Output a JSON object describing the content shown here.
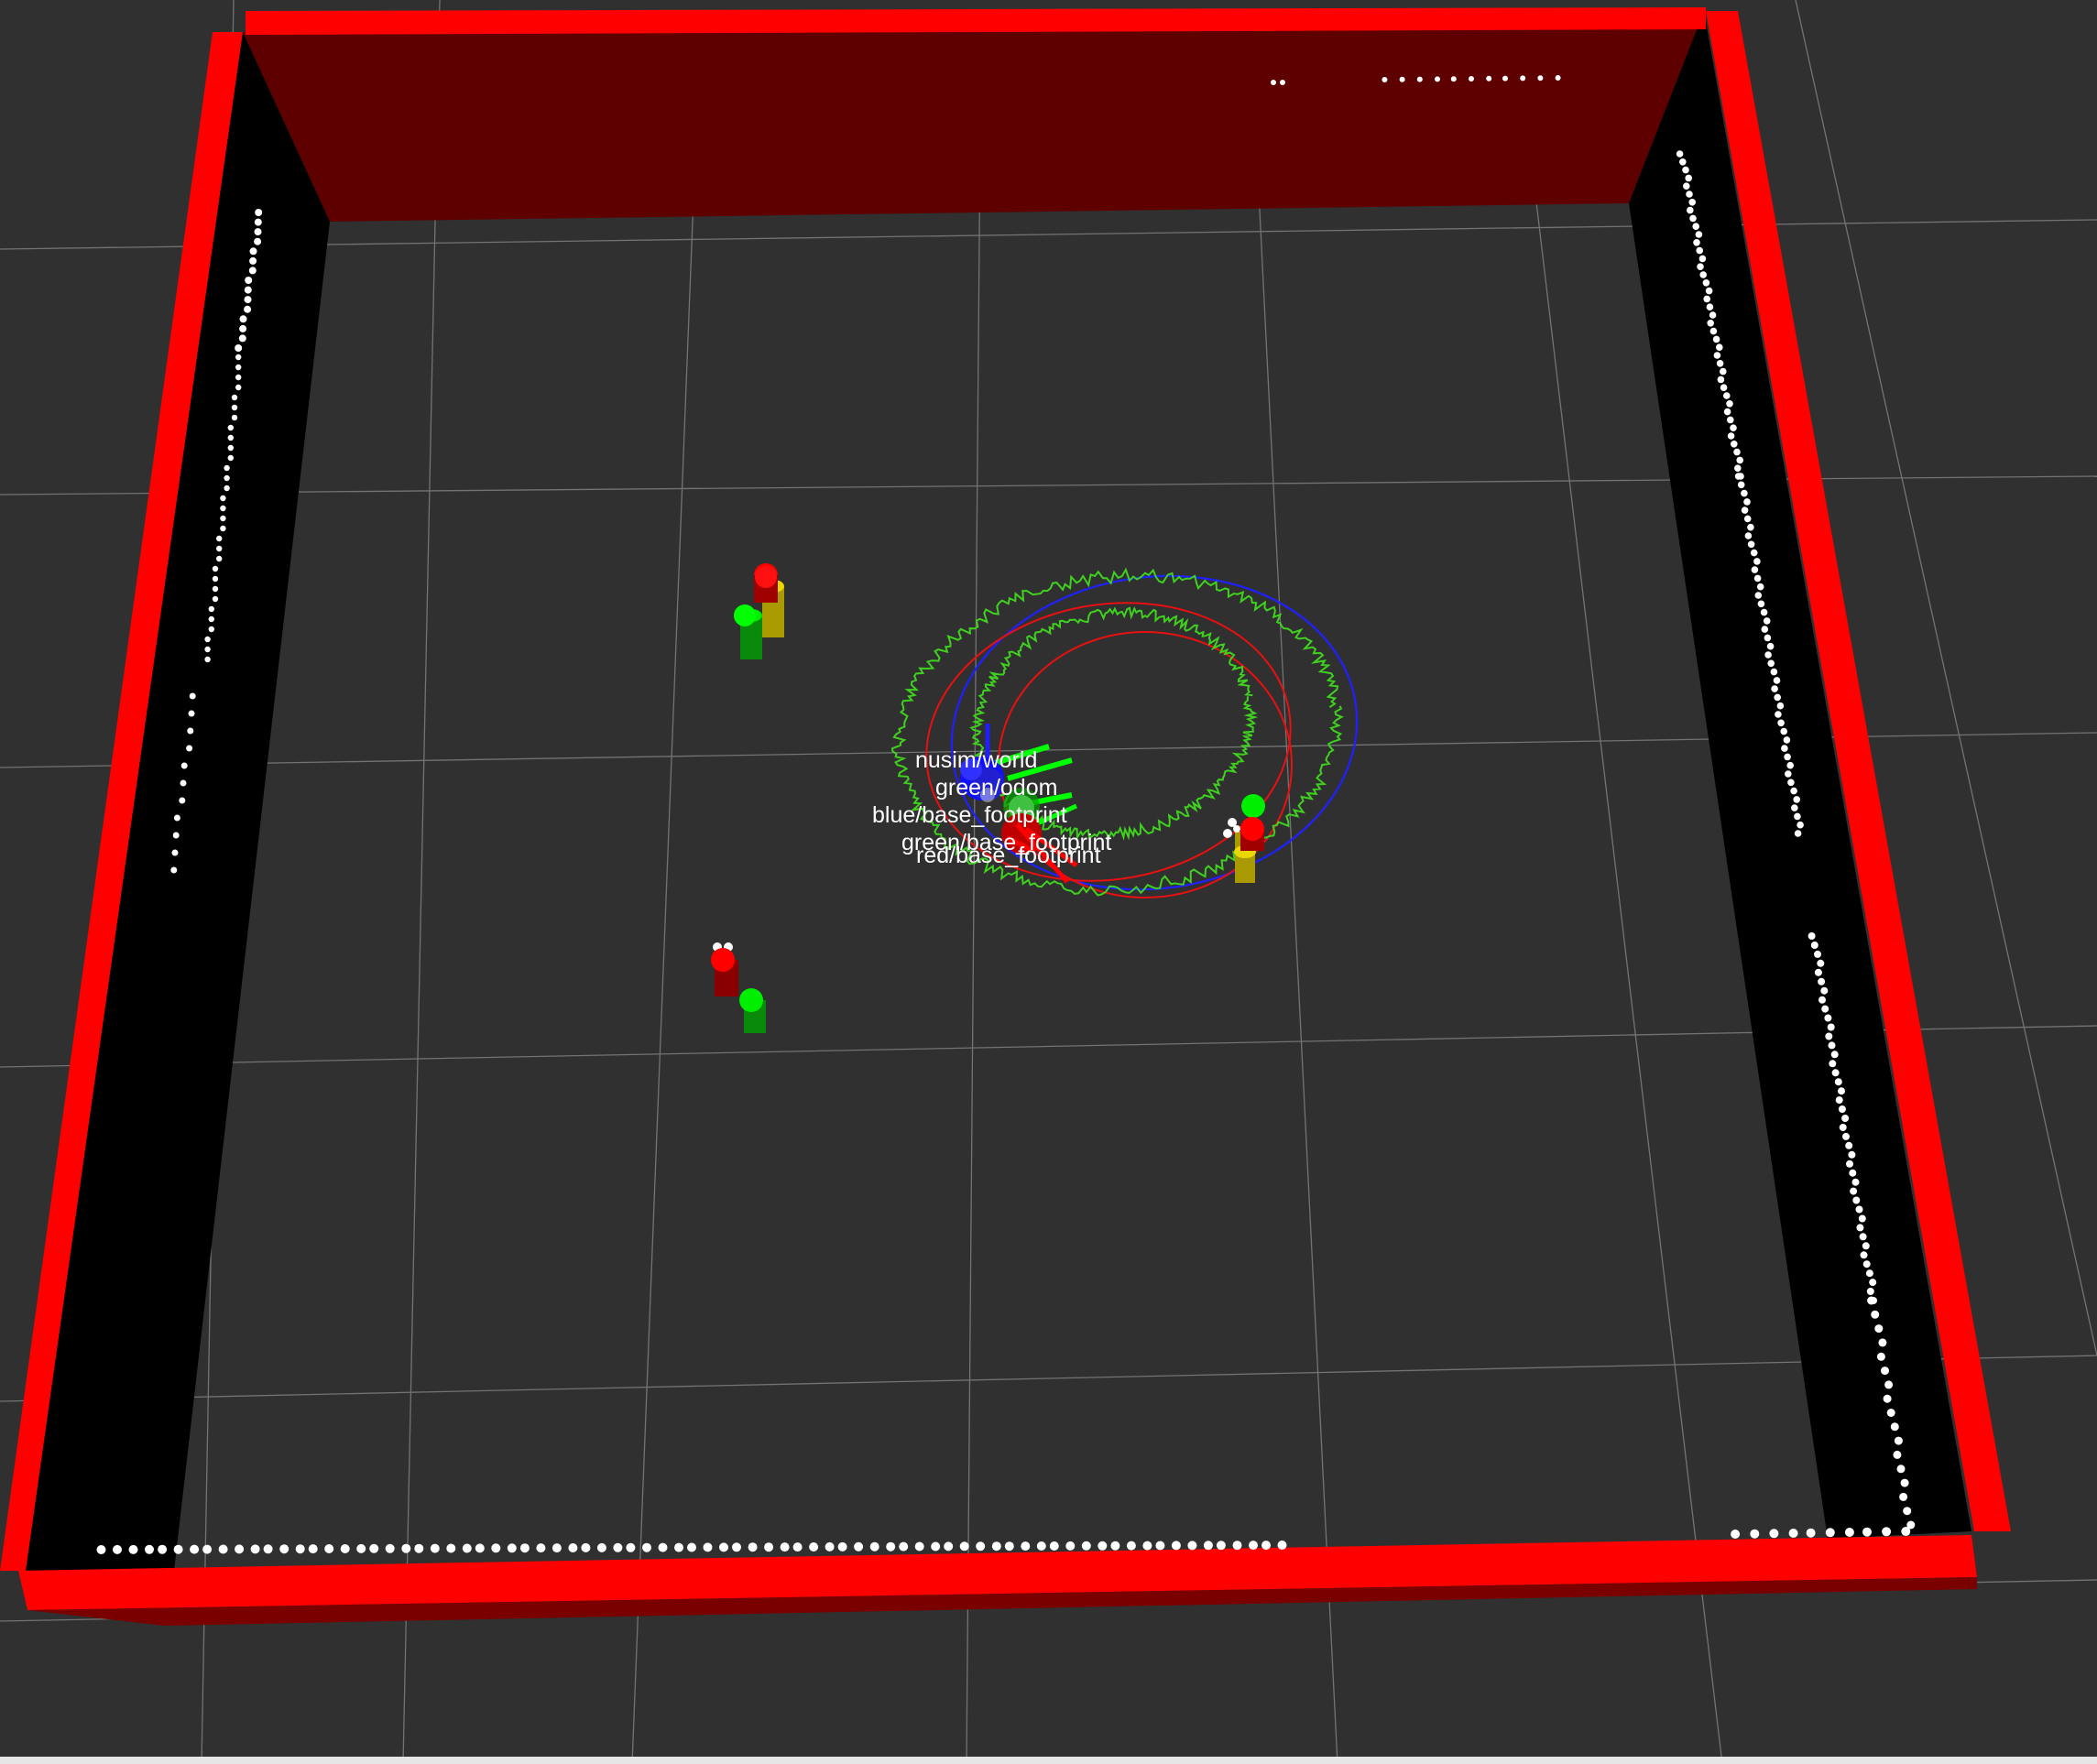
{
  "viewer": {
    "background": "#303030",
    "grid_color": "#8a8a8a",
    "floor_color": "#303030",
    "wall_color": "#ff0000",
    "wall_inner_back": "#5f0000",
    "wall_inner_side": "#000000"
  },
  "tf_frames": [
    {
      "name": "nusim_world_label",
      "text": "nusim/world"
    },
    {
      "name": "green-odom-label",
      "text": "green/odom"
    },
    {
      "name": "blue-base-footprint-label",
      "text": "blue/base_footprint"
    },
    {
      "name": "green-base-footprint-label",
      "text": "green/base_footprint"
    },
    {
      "name": "red-base-footprint-label",
      "text": "red/base_footprint"
    }
  ],
  "robots": {
    "blue": {
      "color": "#0000ff"
    },
    "green": {
      "color": "#00ff00"
    },
    "red": {
      "color": "#ff0000"
    }
  },
  "obstacles": [
    {
      "name": "obstacle-1",
      "colors": [
        "#ff0000",
        "#00ff00",
        "#c8b400"
      ]
    },
    {
      "name": "obstacle-2",
      "colors": [
        "#ff0000",
        "#00ff00",
        "#c8b400"
      ]
    },
    {
      "name": "obstacle-3",
      "colors": [
        "#ff0000",
        "#00ff00",
        "#c8b400"
      ]
    }
  ],
  "laser_scan": {
    "color": "#ffffff"
  }
}
